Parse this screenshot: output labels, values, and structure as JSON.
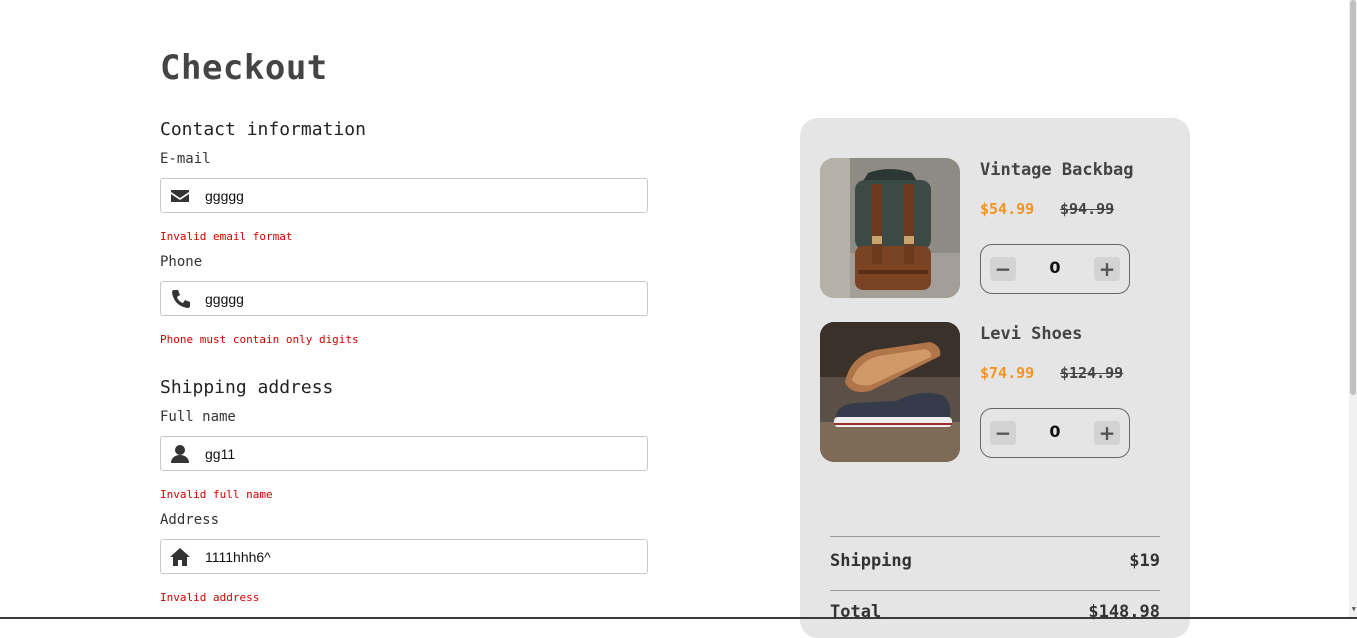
{
  "page": {
    "title": "Checkout"
  },
  "contact": {
    "heading": "Contact information",
    "email": {
      "label": "E-mail",
      "value": "ggggg",
      "error": "Invalid email format",
      "icon": "envelope-icon"
    },
    "phone": {
      "label": "Phone",
      "value": "ggggg",
      "error": "Phone must contain only digits",
      "icon": "phone-icon"
    }
  },
  "shipping": {
    "heading": "Shipping address",
    "full_name": {
      "label": "Full name",
      "value": "gg11",
      "error": "Invalid full name",
      "icon": "user-icon"
    },
    "address": {
      "label": "Address",
      "value": "1111hhh6^",
      "error": "Invalid address",
      "icon": "home-icon"
    }
  },
  "summary": {
    "items": [
      {
        "name": "Vintage Backbag",
        "price": "$54.99",
        "old_price": "$94.99",
        "quantity": "0",
        "image": "backpack-image"
      },
      {
        "name": "Levi Shoes",
        "price": "$74.99",
        "old_price": "$124.99",
        "quantity": "0",
        "image": "shoes-image"
      }
    ],
    "shipping_label": "Shipping",
    "shipping_value": "$19",
    "total_label": "Total",
    "total_value": "$148.98"
  },
  "colors": {
    "price_accent": "#f5931e",
    "error": "#d00000",
    "summary_bg": "#e5e5e5"
  }
}
